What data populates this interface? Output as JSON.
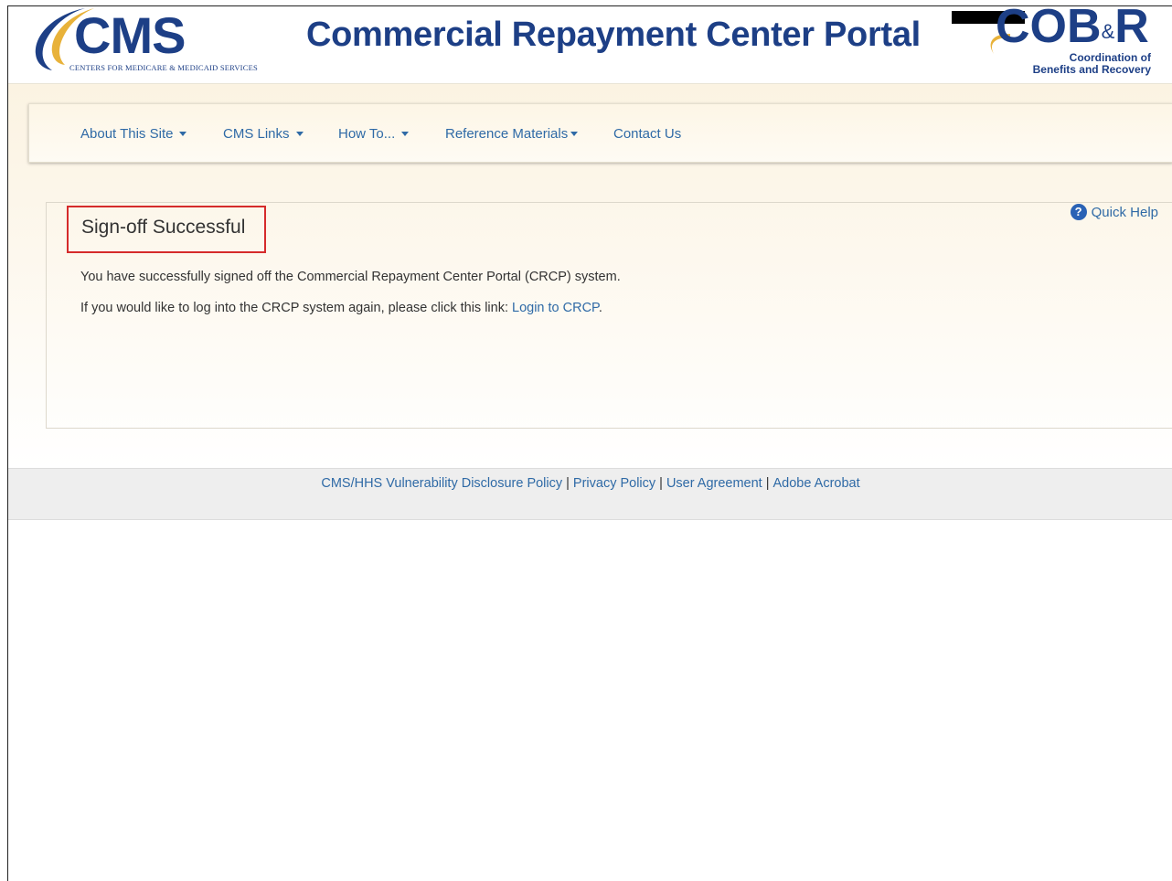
{
  "header": {
    "cms_logo_text": "CMS",
    "cms_logo_subtitle": "CENTERS FOR MEDICARE & MEDICAID SERVICES",
    "portal_title": "Commercial Repayment Center Portal",
    "cobr_logo_main": "COB",
    "cobr_logo_amp": "&",
    "cobr_logo_r": "R",
    "cobr_subtitle_line1": "Coordination of",
    "cobr_subtitle_line2": "Benefits and Recovery"
  },
  "nav": {
    "items": [
      {
        "label": "About This Site",
        "dropdown": true
      },
      {
        "label": "CMS Links",
        "dropdown": true
      },
      {
        "label": "How To...",
        "dropdown": true
      },
      {
        "label": "Reference Materials",
        "dropdown": true
      },
      {
        "label": "Contact Us",
        "dropdown": false
      }
    ]
  },
  "main": {
    "title": "Sign-off Successful",
    "quick_help": "Quick Help",
    "quick_help_icon": "question-circle-icon",
    "message1": "You have successfully signed off the Commercial Repayment Center Portal (CRCP) system.",
    "message2_prefix": "If you would like to log into the CRCP system again, please click this link: ",
    "login_link": "Login to CRCP",
    "message2_suffix": "."
  },
  "footer": {
    "links": [
      "CMS/HHS Vulnerability Disclosure Policy",
      "Privacy Policy",
      "User Agreement",
      "Adobe Acrobat"
    ],
    "separator": "|"
  },
  "colors": {
    "brand_blue": "#1d3f86",
    "link_blue": "#2f6aa6",
    "cms_gold": "#e8b23a",
    "highlight_red": "#d52b2b"
  }
}
